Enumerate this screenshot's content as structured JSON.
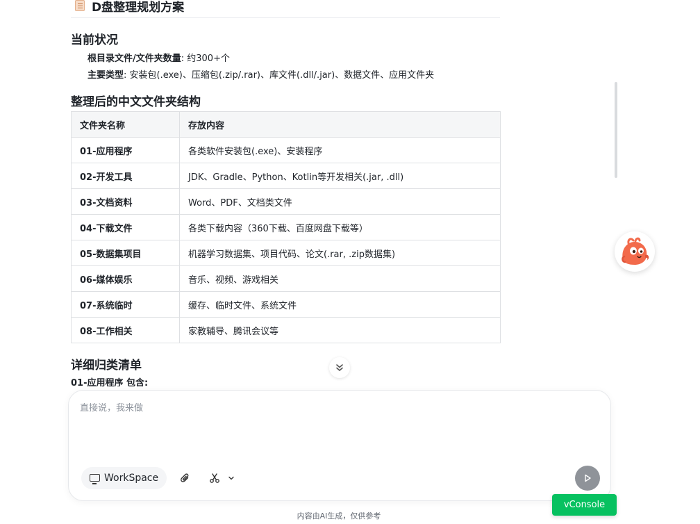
{
  "document": {
    "title": "D盘整理规划方案",
    "title_icon": "document-icon",
    "status": {
      "heading": "当前状况",
      "items": [
        {
          "label": "根目录文件/文件夹数量",
          "value": ": 约300+个"
        },
        {
          "label": "主要类型",
          "value": ": 安装包(.exe)、压缩包(.zip/.rar)、库文件(.dll/.jar)、数据文件、应用文件夹"
        }
      ]
    },
    "structure": {
      "heading": "整理后的中文文件夹结构",
      "columns": [
        "文件夹名称",
        "存放内容"
      ],
      "rows": [
        [
          "01-应用程序",
          "各类软件安装包(.exe)、安装程序"
        ],
        [
          "02-开发工具",
          "JDK、Gradle、Python、Kotlin等开发相关(.jar, .dll)"
        ],
        [
          "03-文档资料",
          "Word、PDF、文档类文件"
        ],
        [
          "04-下载文件",
          "各类下载内容（360下载、百度网盘下载等）"
        ],
        [
          "05-数据集项目",
          "机器学习数据集、项目代码、论文(.rar, .zip数据集)"
        ],
        [
          "06-媒体娱乐",
          "音乐、视频、游戏相关"
        ],
        [
          "07-系统临时",
          "缓存、临时文件、系统文件"
        ],
        [
          "08-工作相关",
          "家教辅导、腾讯会议等"
        ]
      ]
    },
    "detail": {
      "heading": "详细归类清单",
      "partial_line": "01-应用程序 包含:"
    }
  },
  "composer": {
    "placeholder": "直接说，我来做",
    "workspace_label": "WorkSpace",
    "icons": [
      "monitor-icon",
      "paperclip-icon",
      "scissors-icon",
      "chevron-down-icon",
      "send-icon"
    ]
  },
  "vconsole_label": "vConsole",
  "disclaimer": "内容由AI生成，仅供参考",
  "colors": {
    "vconsole_green": "#07c160",
    "send_button": "#8f9399",
    "table_header_bg": "#f5f6f7",
    "mascot_orange": "#f26a4b"
  }
}
